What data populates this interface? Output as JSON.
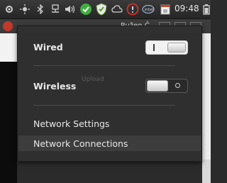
{
  "panel": {
    "clock": "09:48",
    "icons": [
      "settings-icon",
      "sun-icon",
      "bluetooth-icon",
      "network-icon",
      "volume-icon",
      "check-shield-icon",
      "shield-icon",
      "cloud-icon",
      "alert-icon",
      "intel-icon",
      "calendar-icon",
      "battery-icon"
    ]
  },
  "browser": {
    "tab_label": "Ružen Č",
    "ghost_text": "Upload"
  },
  "menu": {
    "wired_label": "Wired",
    "wireless_label": "Wireless",
    "network_settings_label": "Network Settings",
    "network_connections_label": "Network Connections",
    "wired_state": "on",
    "wireless_state": "off"
  }
}
